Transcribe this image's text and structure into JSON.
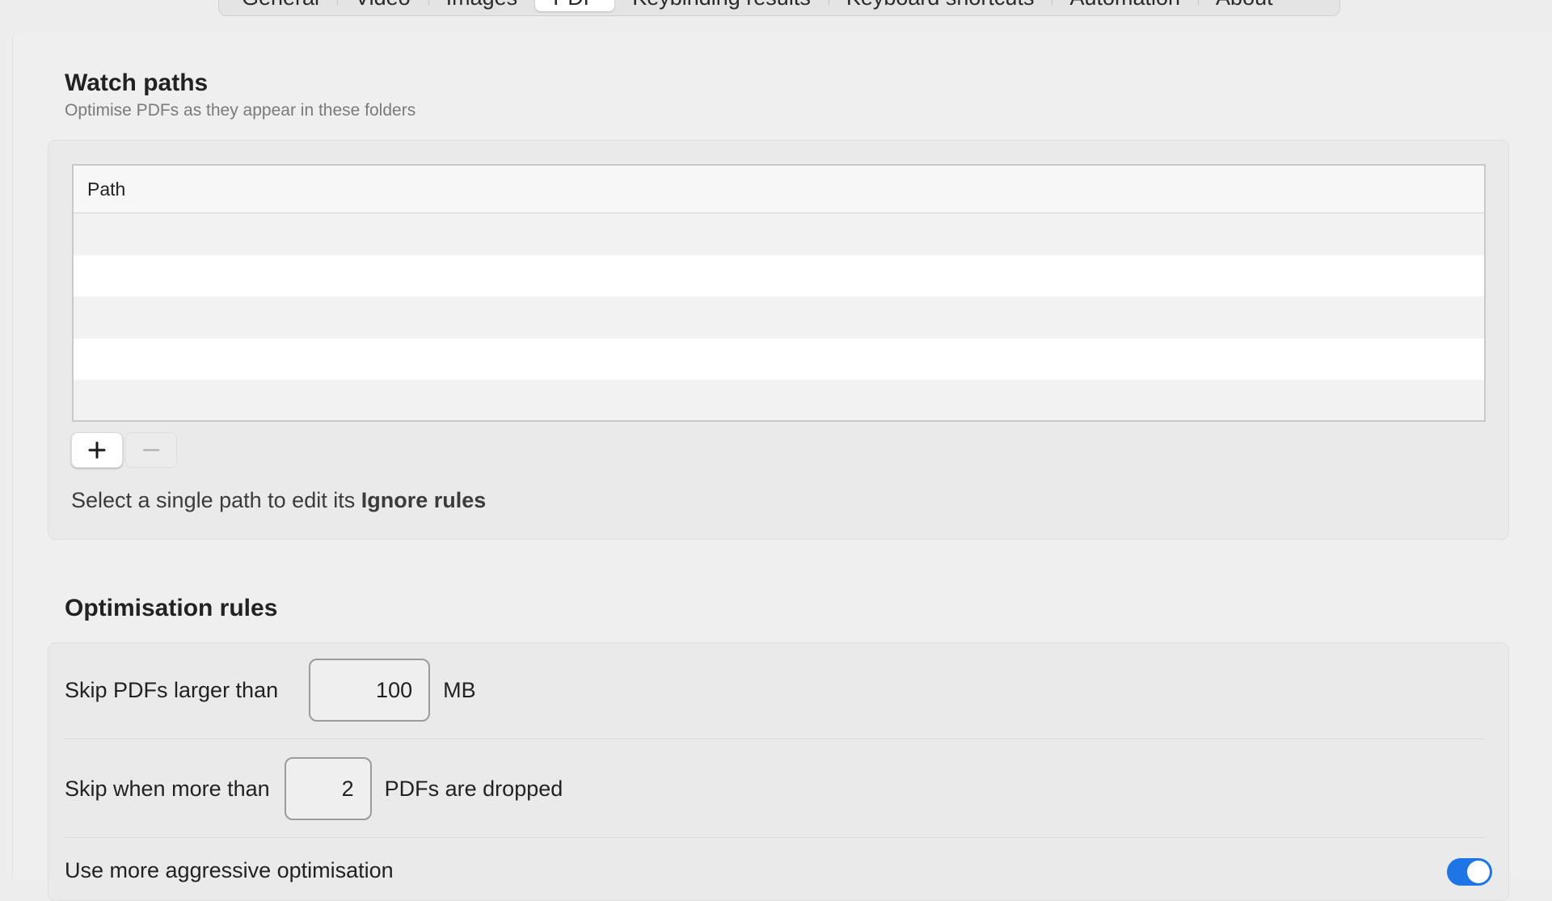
{
  "tabs": [
    {
      "label": "General",
      "active": false
    },
    {
      "label": "Video",
      "active": false
    },
    {
      "label": "Images",
      "active": false
    },
    {
      "label": "PDF",
      "active": true
    },
    {
      "label": "Keybinding results",
      "active": false
    },
    {
      "label": "Keyboard shortcuts",
      "active": false
    },
    {
      "label": "Automation",
      "active": false
    },
    {
      "label": "About",
      "active": false
    }
  ],
  "watch_paths": {
    "title": "Watch paths",
    "subtitle": "Optimise PDFs as they appear in these folders",
    "table": {
      "columns": [
        "Path"
      ],
      "rows": []
    },
    "add_icon": "plus-icon",
    "remove_icon": "minus-icon",
    "hint_prefix": "Select a single path to edit its ",
    "hint_bold": "Ignore rules"
  },
  "optimisation_rules": {
    "title": "Optimisation rules",
    "skip_larger": {
      "label": "Skip PDFs larger than",
      "value": "100",
      "unit": "MB"
    },
    "skip_more": {
      "label": "Skip when more than",
      "value": "2",
      "suffix": "PDFs are dropped"
    },
    "aggressive": {
      "label": "Use more aggressive optimisation",
      "enabled": true
    }
  },
  "colors": {
    "accent": "#1f74e6",
    "background": "#efefef"
  }
}
